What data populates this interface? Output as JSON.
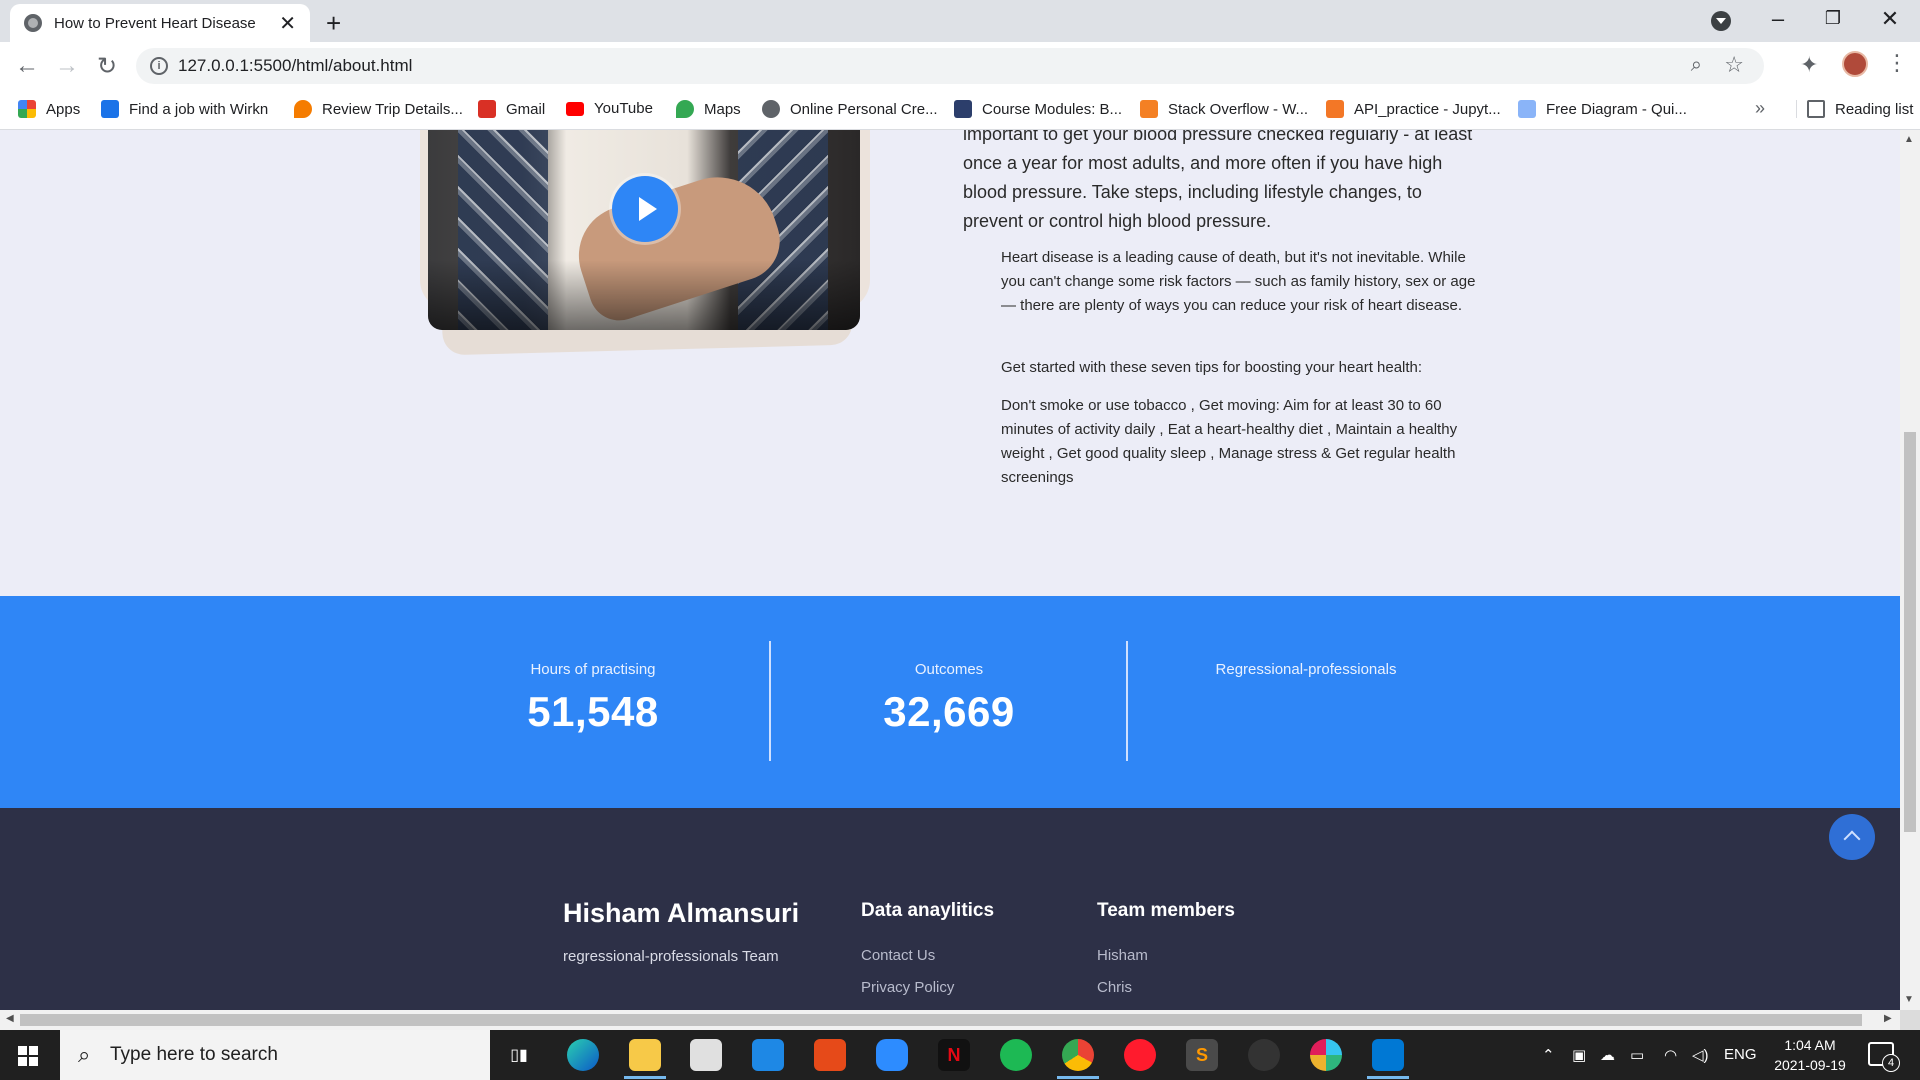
{
  "browser": {
    "tab_title": "How to Prevent Heart Disease",
    "url": "127.0.0.1:5500/html/about.html",
    "bookmarks": [
      {
        "label": "Apps",
        "icon": "apps-grid-icon",
        "color": "#ea4335"
      },
      {
        "label": "Find a job with Wirkn",
        "icon": "wirkn-icon",
        "color": "#1a73e8"
      },
      {
        "label": "Review Trip Details...",
        "icon": "location-pin-icon",
        "color": "#f57c00"
      },
      {
        "label": "Gmail",
        "icon": "gmail-icon",
        "color": "#d93025"
      },
      {
        "label": "YouTube",
        "icon": "youtube-icon",
        "color": "#ff0000"
      },
      {
        "label": "Maps",
        "icon": "maps-icon",
        "color": "#34a853"
      },
      {
        "label": "Online Personal Cre...",
        "icon": "globe-icon",
        "color": "#5f6368"
      },
      {
        "label": "Course Modules: B...",
        "icon": "course-icon",
        "color": "#2c3e6b"
      },
      {
        "label": "Stack Overflow - W...",
        "icon": "stackoverflow-icon",
        "color": "#f48024"
      },
      {
        "label": "API_practice - Jupyt...",
        "icon": "jupyter-icon",
        "color": "#f37726"
      },
      {
        "label": "Free Diagram - Qui...",
        "icon": "diagram-icon",
        "color": "#8ab4f8"
      }
    ],
    "more_label": "»",
    "reading_list": "Reading list"
  },
  "content": {
    "intro": "important to get your blood pressure checked regularly - at least once a year for most adults, and more often if you have high blood pressure. Take steps, including lifestyle changes, to prevent or control high blood pressure.",
    "p1": "Heart disease is a leading cause of death, but it's not inevitable. While you can't change some risk factors — such as family history, sex or age — there are plenty of ways you can reduce your risk of heart disease.",
    "p2": "Get started with these seven tips for boosting your heart health:",
    "p3": "Don't smoke or use tobacco , Get moving: Aim for at least 30 to 60 minutes of activity daily , Eat a heart-healthy diet , Maintain a healthy weight , Get good quality sleep , Manage stress & Get regular health screenings"
  },
  "stats": [
    {
      "label": "Hours of practising",
      "value": "51,548"
    },
    {
      "label": "Outcomes",
      "value": "32,669"
    },
    {
      "label": "Regressional-professionals",
      "value": ""
    }
  ],
  "footer": {
    "name": "Hisham Almansuri",
    "subtitle": "regressional-professionals Team",
    "col1_title": "Data anaylitics",
    "col1_links": [
      "Contact Us",
      "Privacy Policy"
    ],
    "col2_title": "Team members",
    "col2_links": [
      "Hisham",
      "Chris"
    ]
  },
  "taskbar": {
    "search_placeholder": "Type here to search",
    "lang": "ENG",
    "time": "1:04 AM",
    "date": "2021-09-19",
    "notifications": "4"
  },
  "colors": {
    "accent_blue": "#2f86f6",
    "footer_bg": "#2d3047",
    "page_bg": "#ecedf7"
  }
}
